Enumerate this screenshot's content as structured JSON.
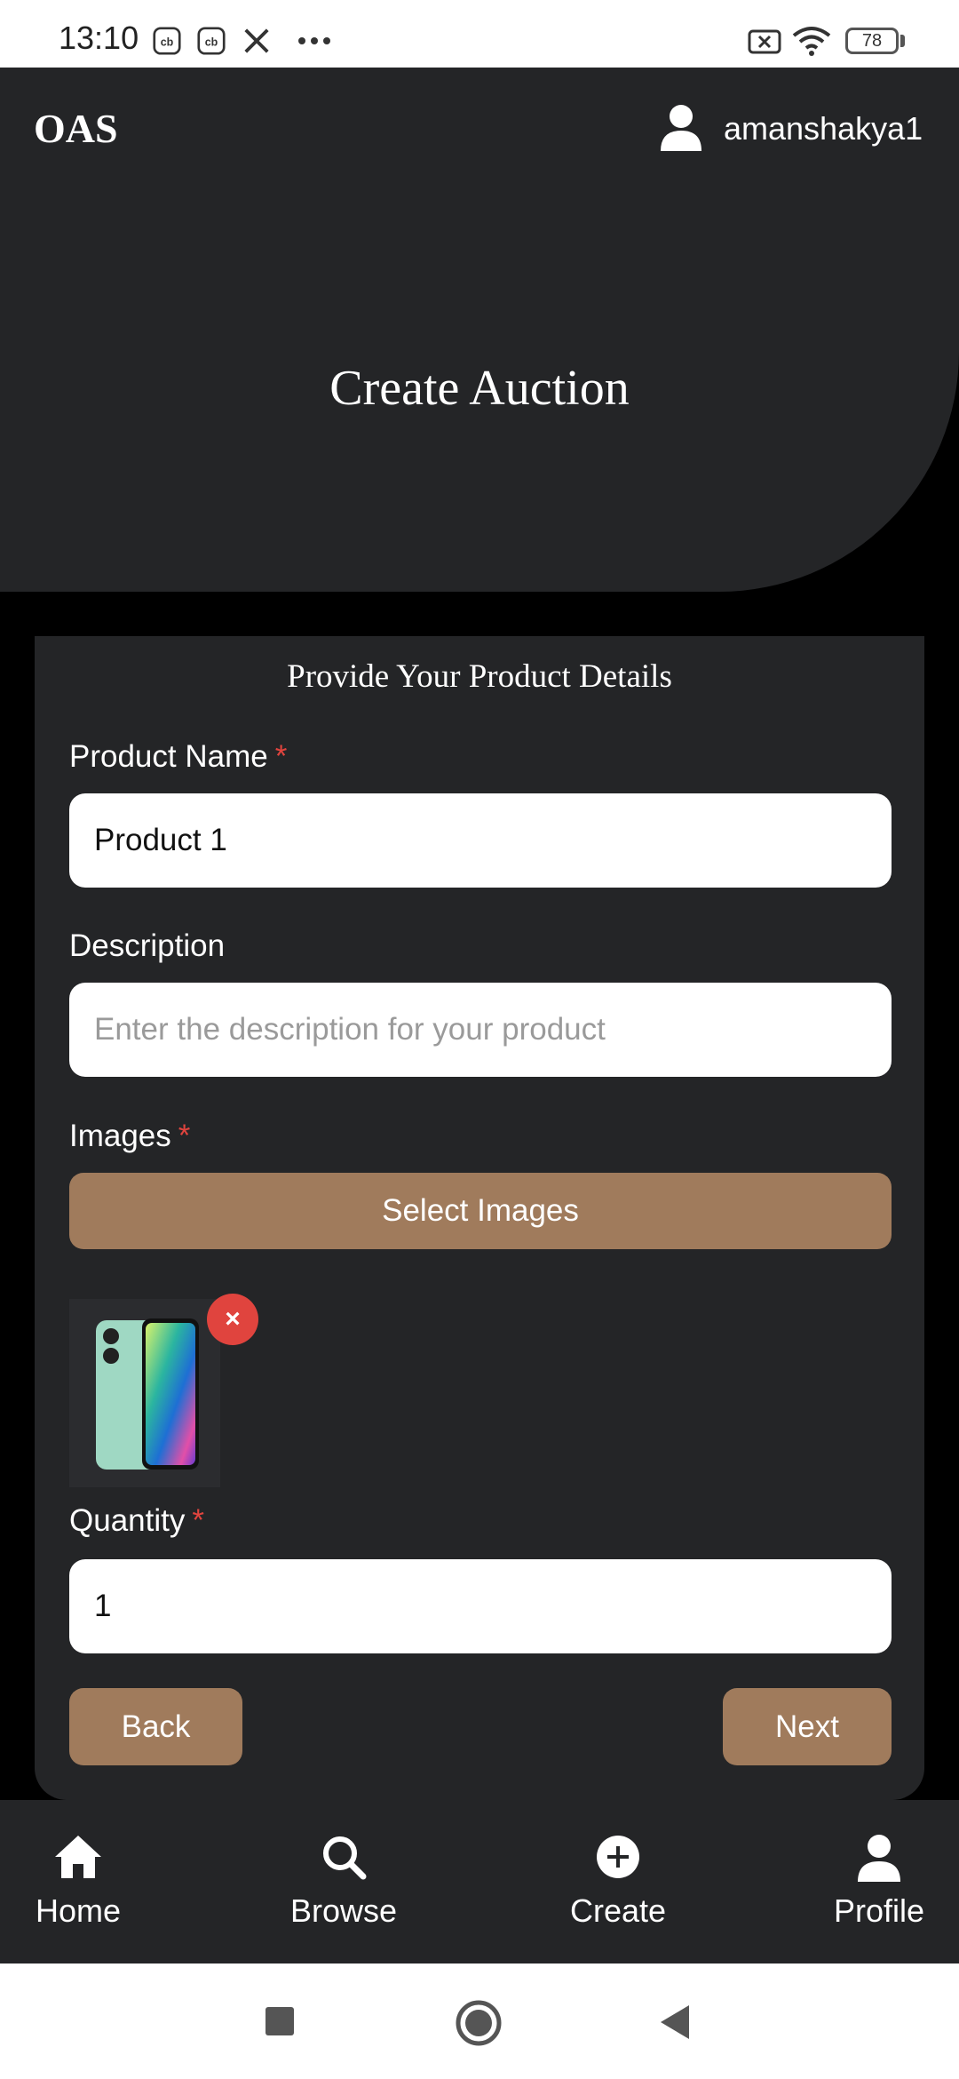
{
  "status_bar": {
    "time": "13:10",
    "battery": "78",
    "icons": [
      "cb-icon",
      "cb-icon",
      "x-icon",
      "more-dots-icon",
      "sim-off-icon",
      "wifi-icon",
      "battery-icon"
    ]
  },
  "header": {
    "logo": "OAS",
    "username": "amanshakya1",
    "title": "Create Auction"
  },
  "form": {
    "title": "Provide Your Product Details",
    "product_name": {
      "label": "Product Name",
      "required": "*",
      "value": "Product 1"
    },
    "description": {
      "label": "Description",
      "placeholder": "Enter the description for your product",
      "value": ""
    },
    "images": {
      "label": "Images",
      "required": "*",
      "button_label": "Select Images",
      "remove_label": "×"
    },
    "quantity": {
      "label": "Quantity",
      "required": "*",
      "value": "1"
    },
    "back_label": "Back",
    "next_label": "Next"
  },
  "bottom_nav": {
    "items": [
      {
        "label": "Home",
        "icon": "home-icon"
      },
      {
        "label": "Browse",
        "icon": "search-icon"
      },
      {
        "label": "Create",
        "icon": "plus-circle-icon"
      },
      {
        "label": "Profile",
        "icon": "profile-icon"
      }
    ]
  },
  "colors": {
    "background": "#000000",
    "surface": "#242527",
    "accent": "#a07b5c",
    "required": "#e0443e"
  }
}
